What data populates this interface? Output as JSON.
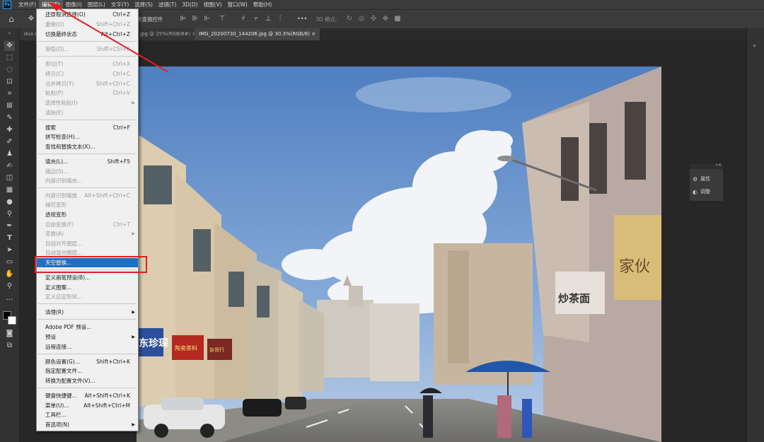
{
  "menubar": {
    "logo": "Ps",
    "items": [
      "文件(F)",
      "编辑(E)",
      "图像(I)",
      "图层(L)",
      "文字(Y)",
      "选择(S)",
      "滤镜(T)",
      "3D(D)",
      "视图(V)",
      "窗口(W)",
      "帮助(H)"
    ],
    "active_index": 1
  },
  "optionsbar": {
    "transform_controls": "示变换控件",
    "mode_3d": "3D 模式:",
    "more": "•••"
  },
  "tabs": [
    {
      "label": "dva ("
    },
    {
      "label": "jpg @ 25%(RGB/8#)",
      "close": "×"
    },
    {
      "label": "IMG_20200730_144206.jpg @ 30.3%(RGB/8)",
      "close": "×"
    }
  ],
  "panel": {
    "properties": "属性",
    "adjustments": "调整"
  },
  "edit_menu": {
    "items": [
      {
        "label": "还原取消选择(O)",
        "shortcut": "Ctrl+Z",
        "enabled": true
      },
      {
        "label": "重做(O)",
        "shortcut": "Shift+Ctrl+Z",
        "enabled": false
      },
      {
        "label": "切换最终状态",
        "shortcut": "Alt+Ctrl+Z",
        "enabled": true
      },
      {
        "label": "渐隐(D)...",
        "shortcut": "Shift+Ctrl+F",
        "enabled": false
      },
      {
        "label": "剪切(T)",
        "shortcut": "Ctrl+X",
        "enabled": false
      },
      {
        "label": "拷贝(C)",
        "shortcut": "Ctrl+C",
        "enabled": false
      },
      {
        "label": "合并拷贝(Y)",
        "shortcut": "Shift+Ctrl+C",
        "enabled": false
      },
      {
        "label": "粘贴(P)",
        "shortcut": "Ctrl+V",
        "enabled": false
      },
      {
        "label": "选择性粘贴(I)",
        "submenu": true,
        "enabled": false
      },
      {
        "label": "清除(E)",
        "enabled": false
      },
      {
        "label": "搜索",
        "shortcut": "Ctrl+F",
        "enabled": true
      },
      {
        "label": "拼写检查(H)...",
        "enabled": true
      },
      {
        "label": "查找和替换文本(X)...",
        "enabled": true
      },
      {
        "label": "填充(L)...",
        "shortcut": "Shift+F5",
        "enabled": true
      },
      {
        "label": "描边(S)...",
        "enabled": false
      },
      {
        "label": "内容识别填充...",
        "enabled": false
      },
      {
        "label": "内容识别缩放",
        "shortcut": "Alt+Shift+Ctrl+C",
        "enabled": false
      },
      {
        "label": "操控变形",
        "enabled": false
      },
      {
        "label": "透视变形",
        "enabled": true
      },
      {
        "label": "自由变换(F)",
        "shortcut": "Ctrl+T",
        "enabled": false
      },
      {
        "label": "变换(A)",
        "submenu": true,
        "enabled": false
      },
      {
        "label": "自动对齐图层...",
        "enabled": false
      },
      {
        "label": "自动混合图层...",
        "enabled": false
      },
      {
        "label": "天空替换...",
        "enabled": true,
        "highlighted": true
      },
      {
        "label": "定义画笔预设(B)...",
        "enabled": true
      },
      {
        "label": "定义图案...",
        "enabled": true
      },
      {
        "label": "定义自定形状...",
        "enabled": false
      },
      {
        "label": "清理(R)",
        "submenu": true,
        "enabled": true
      },
      {
        "label": "Adobe PDF 预设...",
        "enabled": true
      },
      {
        "label": "预设",
        "submenu": true,
        "enabled": true
      },
      {
        "label": "远程连接...",
        "enabled": true
      },
      {
        "label": "颜色设置(G)...",
        "shortcut": "Shift+Ctrl+K",
        "enabled": true
      },
      {
        "label": "指定配置文件...",
        "enabled": true
      },
      {
        "label": "转换为配置文件(V)...",
        "enabled": true
      },
      {
        "label": "键盘快捷键...",
        "shortcut": "Alt+Shift+Ctrl+K",
        "enabled": true
      },
      {
        "label": "菜单(U)...",
        "shortcut": "Alt+Shift+Ctrl+M",
        "enabled": true
      },
      {
        "label": "工具栏...",
        "enabled": true
      },
      {
        "label": "首选项(N)",
        "submenu": true,
        "enabled": true
      }
    ]
  },
  "photo": {
    "sign_left": "东珍琛",
    "sign_mid1": "陶瓷茶料",
    "sign_mid2": "杂货行",
    "sign_right": "炒茶面",
    "sign_corner": "家伙"
  },
  "colors": {
    "menu_highlight": "#1f6fc5",
    "annotation": "#e02020",
    "sky": "#6f99d1"
  }
}
